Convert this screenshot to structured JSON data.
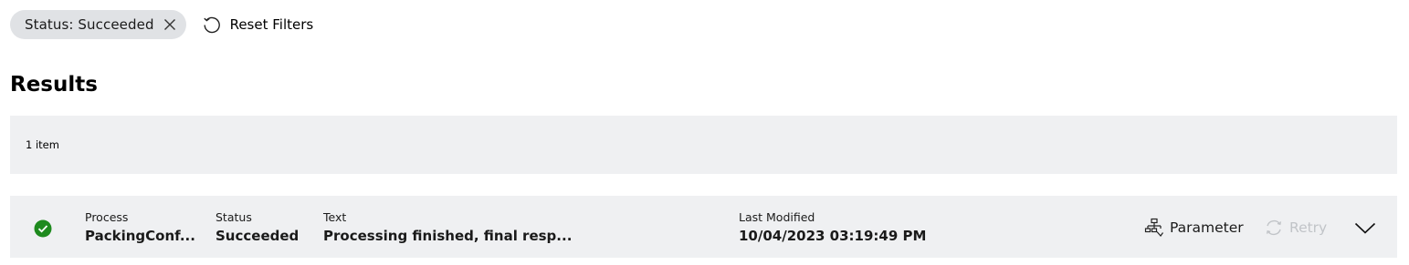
{
  "filters": {
    "chip_label": "Status: Succeeded",
    "reset_label": "Reset Filters"
  },
  "results": {
    "title": "Results",
    "count_label": "1 item"
  },
  "rows": [
    {
      "process_label": "Process",
      "process_value": "PackingConf...",
      "status_label": "Status",
      "status_value": "Succeeded",
      "text_label": "Text",
      "text_value": "Processing finished, final resp...",
      "modified_label": "Last Modified",
      "modified_value": "10/04/2023 03:19:49 PM",
      "parameter_label": "Parameter",
      "retry_label": "Retry",
      "status_icon": "check-circle-icon",
      "status_color": "#1e8a1e"
    }
  ],
  "colors": {
    "chip_bg": "#e0e2e5",
    "panel_bg": "#eff0f2",
    "disabled": "#c1c4c8"
  }
}
